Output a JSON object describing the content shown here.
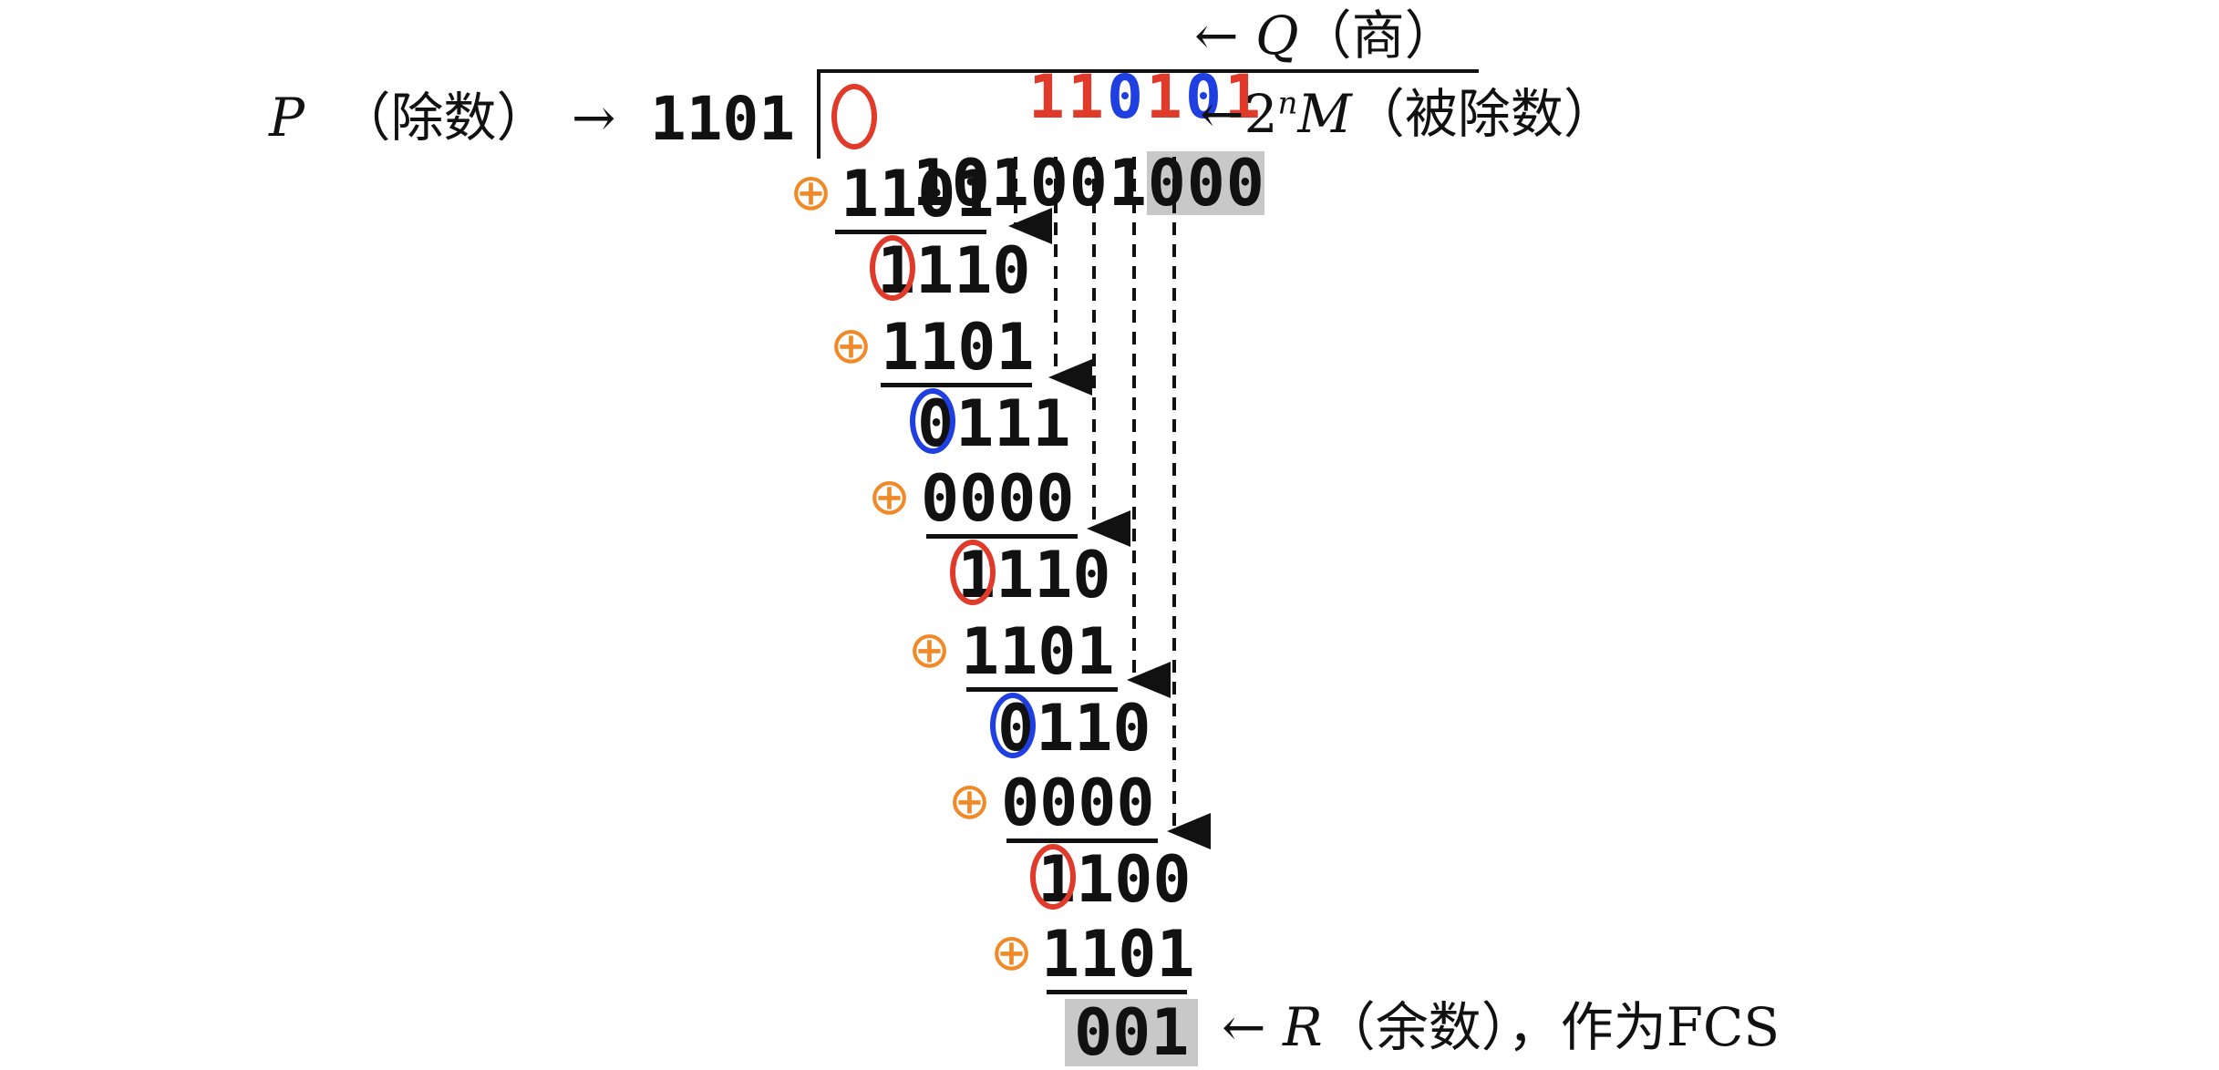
{
  "quotient": {
    "digits": [
      "1",
      "1",
      "0",
      "1",
      "0",
      "1"
    ],
    "digit_colors": [
      "#e03a2a",
      "#e03a2a",
      "#1f3fe0",
      "#e03a2a",
      "#1f3fe0",
      "#e03a2a"
    ],
    "arrow": "←",
    "symbol": "Q",
    "label": "（商）"
  },
  "divisor": {
    "symbol": "P",
    "label": "（除数）",
    "arrow": "→",
    "value": "1101"
  },
  "dividend": {
    "digits": [
      "1",
      "0",
      "1",
      "0",
      "0",
      "1",
      "0",
      "0",
      "0"
    ],
    "arrow": "←",
    "label_base": "2",
    "label_sup": "n",
    "label_symbol": "M",
    "label": "（被除数）"
  },
  "steps": [
    {
      "operator": "⊕",
      "operand": "1101",
      "result": "1110",
      "result_lead_color": "#e03a2a"
    },
    {
      "operator": "⊕",
      "operand": "1101",
      "result": "0111",
      "result_lead_color": "#1f3fe0"
    },
    {
      "operator": "⊕",
      "operand": "0000",
      "result": "1110",
      "result_lead_color": "#e03a2a"
    },
    {
      "operator": "⊕",
      "operand": "1101",
      "result": "0110",
      "result_lead_color": "#1f3fe0"
    },
    {
      "operator": "⊕",
      "operand": "0000",
      "result": "1100",
      "result_lead_color": "#e03a2a"
    },
    {
      "operator": "⊕",
      "operand": "1101",
      "result": "001",
      "result_lead_color": ""
    }
  ],
  "remainder": {
    "value": "001",
    "arrow": "←",
    "symbol": "R",
    "label": "（余数），作为FCS"
  },
  "colors": {
    "one_marker": "#e03a2a",
    "zero_marker": "#1f3fe0",
    "xor_operator": "#f08a28",
    "shade": "#c8c8c8"
  }
}
